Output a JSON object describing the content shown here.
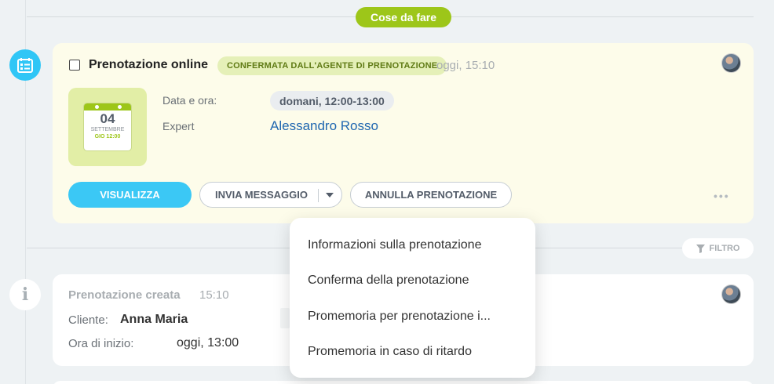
{
  "section": {
    "badge": "Cose da fare"
  },
  "booking": {
    "title": "Prenotazione online",
    "status_badge": "CONFERMATA DALL'AGENTE DI PRENOTAZIONE",
    "time": "oggi, 15:10",
    "calendar": {
      "day": "04",
      "month": "SETTEMBRE",
      "weekday": "GIO 12:00"
    },
    "fields": {
      "date_label": "Data e ora:",
      "date_value": "domani, 12:00-13:00",
      "expert_label": "Expert",
      "expert_value": "Alessandro Rosso"
    },
    "actions": {
      "view": "VISUALIZZA",
      "send_message": "INVIA MESSAGGIO",
      "cancel": "ANNULLA PRENOTAZIONE",
      "more": "•••"
    }
  },
  "filter": {
    "label": "FILTRO"
  },
  "history": {
    "title": "Prenotazione creata",
    "time": "15:10",
    "client_label": "Cliente:",
    "client_value": "Anna Maria",
    "start_label": "Ora di inizio:",
    "start_value": "oggi, 13:00"
  },
  "message_menu": {
    "items": [
      "Informazioni sulla prenotazione",
      "Conferma della prenotazione",
      "Promemoria per prenotazione i...",
      "Promemoria in caso di ritardo"
    ]
  },
  "colors": {
    "accent_green": "#9dc619",
    "accent_blue": "#3bc8f5",
    "link_blue": "#2067b0",
    "card_highlight": "#fdfcea"
  },
  "icons": {
    "booking": "calendar-list-icon",
    "info": "info-icon",
    "filter": "filter-funnel-icon",
    "dropdown": "chevron-down-icon"
  }
}
